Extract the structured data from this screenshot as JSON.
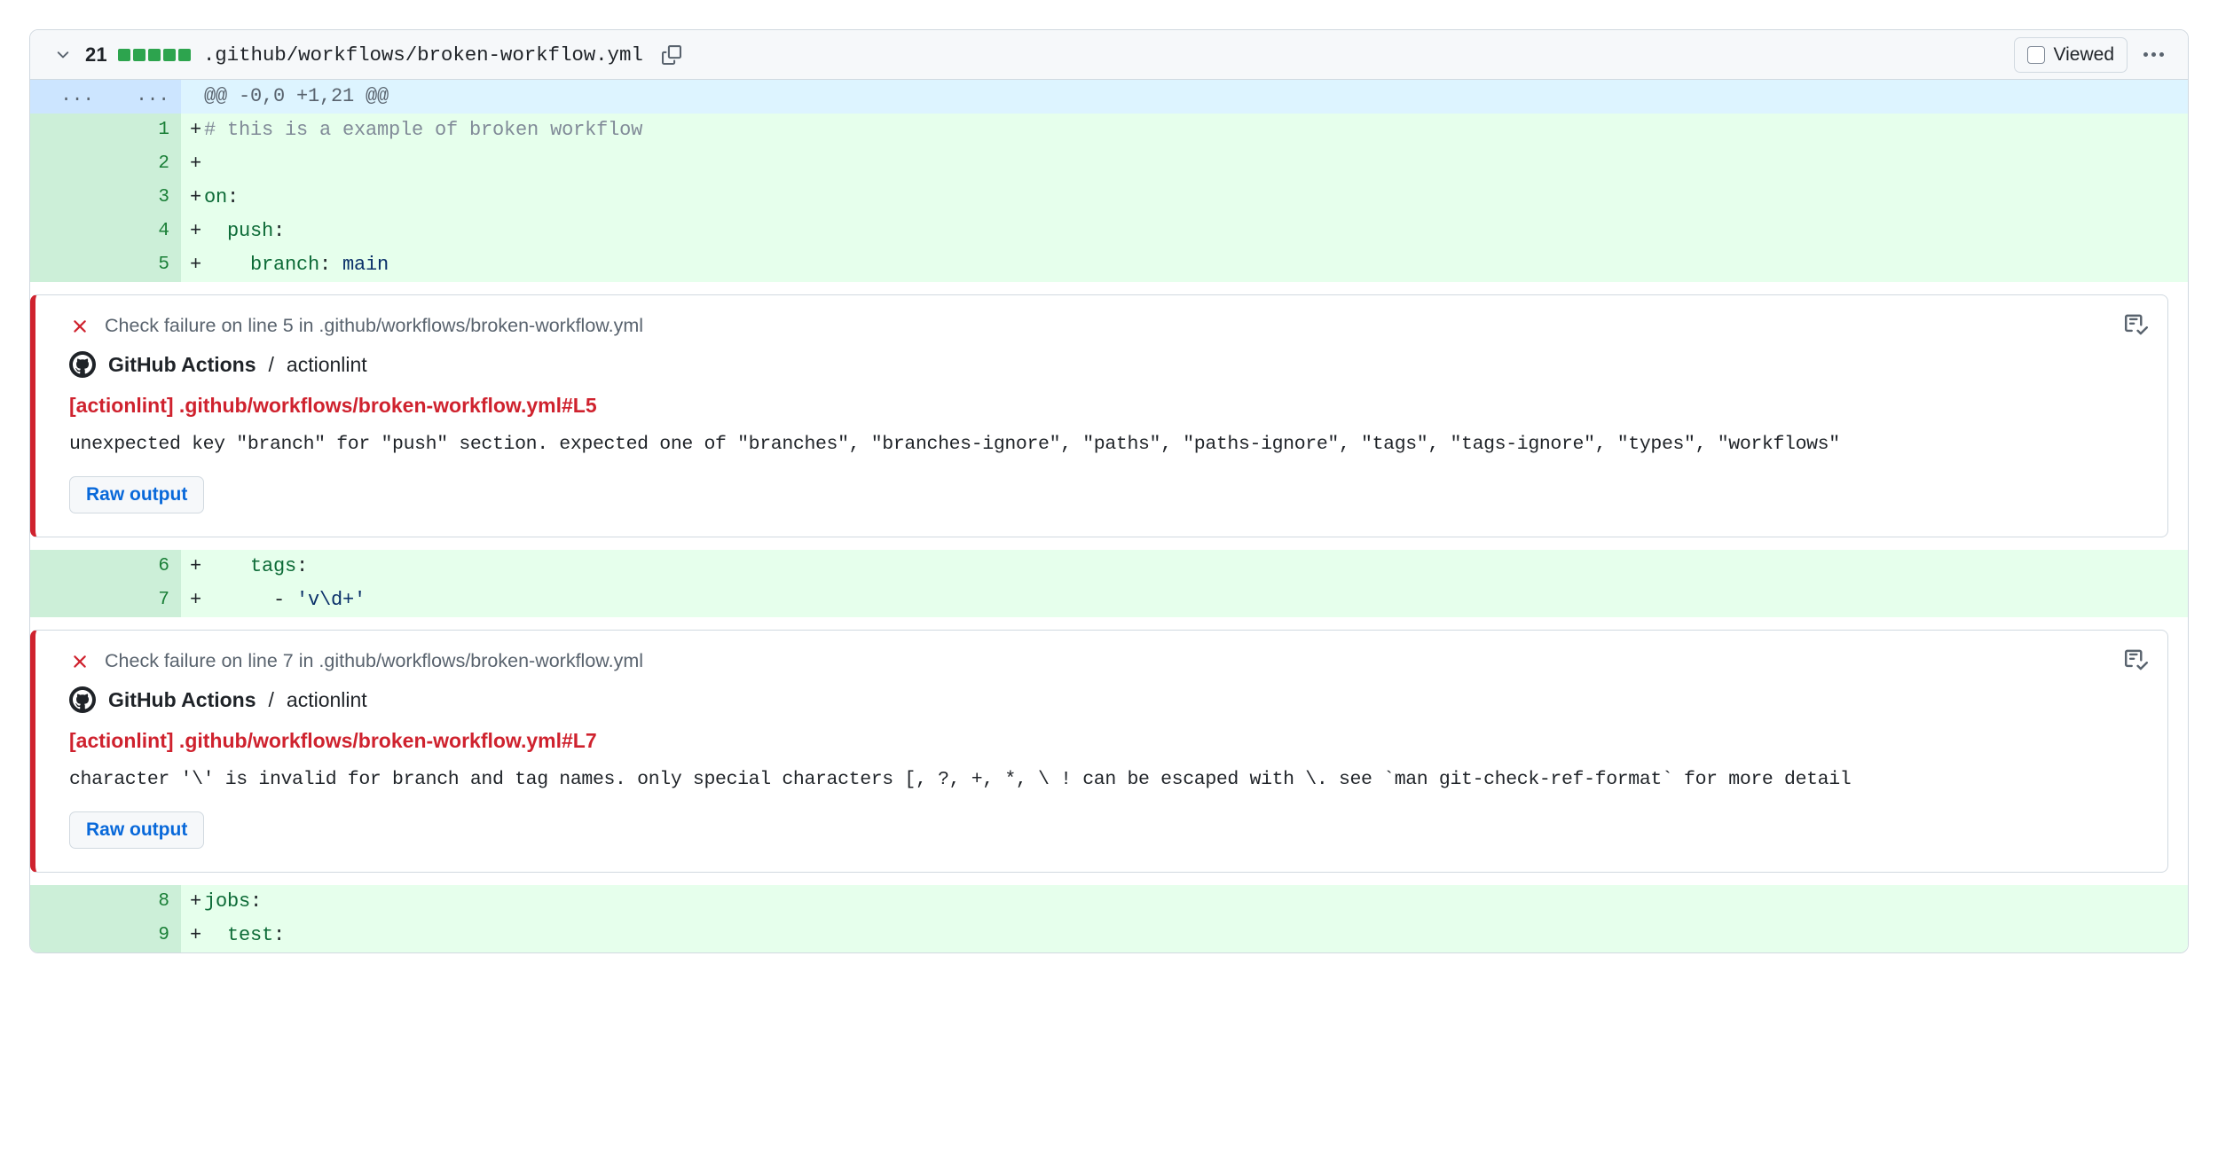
{
  "file_header": {
    "chevron_icon": "chevron-down-icon",
    "change_count": "21",
    "diffstat_squares": 5,
    "diffstat_color": "#2da44e",
    "file_path": ".github/workflows/broken-workflow.yml",
    "copy_icon": "clipboard-copy-icon",
    "viewed_label": "Viewed",
    "viewed_checked": false,
    "kebab_icon": "kebab-horizontal-icon"
  },
  "hunk": {
    "gutter_a": "...",
    "gutter_b": "...",
    "header": "@@ -0,0 +1,21 @@"
  },
  "diff_rows": [
    {
      "num": "1",
      "marker": "+",
      "segments": [
        {
          "t": "# this is a example of broken workflow",
          "c": "y-comment"
        }
      ]
    },
    {
      "num": "2",
      "marker": "+",
      "segments": [
        {
          "t": "",
          "c": "y-punct"
        }
      ]
    },
    {
      "num": "3",
      "marker": "+",
      "segments": [
        {
          "t": "on",
          "c": "y-key"
        },
        {
          "t": ":",
          "c": "y-punct"
        }
      ]
    },
    {
      "num": "4",
      "marker": "+",
      "segments": [
        {
          "t": "  push",
          "c": "y-key"
        },
        {
          "t": ":",
          "c": "y-punct"
        }
      ]
    },
    {
      "num": "5",
      "marker": "+",
      "segments": [
        {
          "t": "    branch",
          "c": "y-key"
        },
        {
          "t": ": ",
          "c": "y-punct"
        },
        {
          "t": "main",
          "c": "y-val"
        }
      ]
    },
    {
      "num": "6",
      "marker": "+",
      "segments": [
        {
          "t": "    tags",
          "c": "y-key"
        },
        {
          "t": ":",
          "c": "y-punct"
        }
      ]
    },
    {
      "num": "7",
      "marker": "+",
      "segments": [
        {
          "t": "      - ",
          "c": "y-punct"
        },
        {
          "t": "'v\\d+'",
          "c": "y-str"
        }
      ]
    },
    {
      "num": "8",
      "marker": "+",
      "segments": [
        {
          "t": "jobs",
          "c": "y-key"
        },
        {
          "t": ":",
          "c": "y-punct"
        }
      ]
    },
    {
      "num": "9",
      "marker": "+",
      "segments": [
        {
          "t": "  test",
          "c": "y-key"
        },
        {
          "t": ":",
          "c": "y-punct"
        }
      ]
    }
  ],
  "annotations": [
    {
      "status_icon": "x-circle-fail-icon",
      "head_text": "Check failure on line 5 in .github/workflows/broken-workflow.yml",
      "task_icon": "checklist-icon",
      "avatar_icon": "github-mark-icon",
      "actor": "GitHub Actions",
      "separator": "/",
      "check_name": "actionlint",
      "title": "[actionlint] .github/workflows/broken-workflow.yml#L5",
      "message": "unexpected key \"branch\" for \"push\" section. expected one of \"branches\", \"branches-ignore\", \"paths\", \"paths-ignore\", \"tags\", \"tags-ignore\", \"types\", \"workflows\"",
      "raw_output_label": "Raw output"
    },
    {
      "status_icon": "x-circle-fail-icon",
      "head_text": "Check failure on line 7 in .github/workflows/broken-workflow.yml",
      "task_icon": "checklist-icon",
      "avatar_icon": "github-mark-icon",
      "actor": "GitHub Actions",
      "separator": "/",
      "check_name": "actionlint",
      "title": "[actionlint] .github/workflows/broken-workflow.yml#L7",
      "message": "character '\\' is invalid for branch and tag names. only special characters [, ?, +, *, \\ ! can be escaped with \\. see `man git-check-ref-format` for more detail",
      "raw_output_label": "Raw output"
    }
  ],
  "colors": {
    "addition_bg": "#e6ffec",
    "addition_gutter": "#ccefd8",
    "hunk_bg": "#ddf4ff",
    "hunk_gutter": "#cce5ff",
    "fail_red": "#cf222e",
    "link_blue": "#0969da",
    "border": "#d1d9e0"
  }
}
